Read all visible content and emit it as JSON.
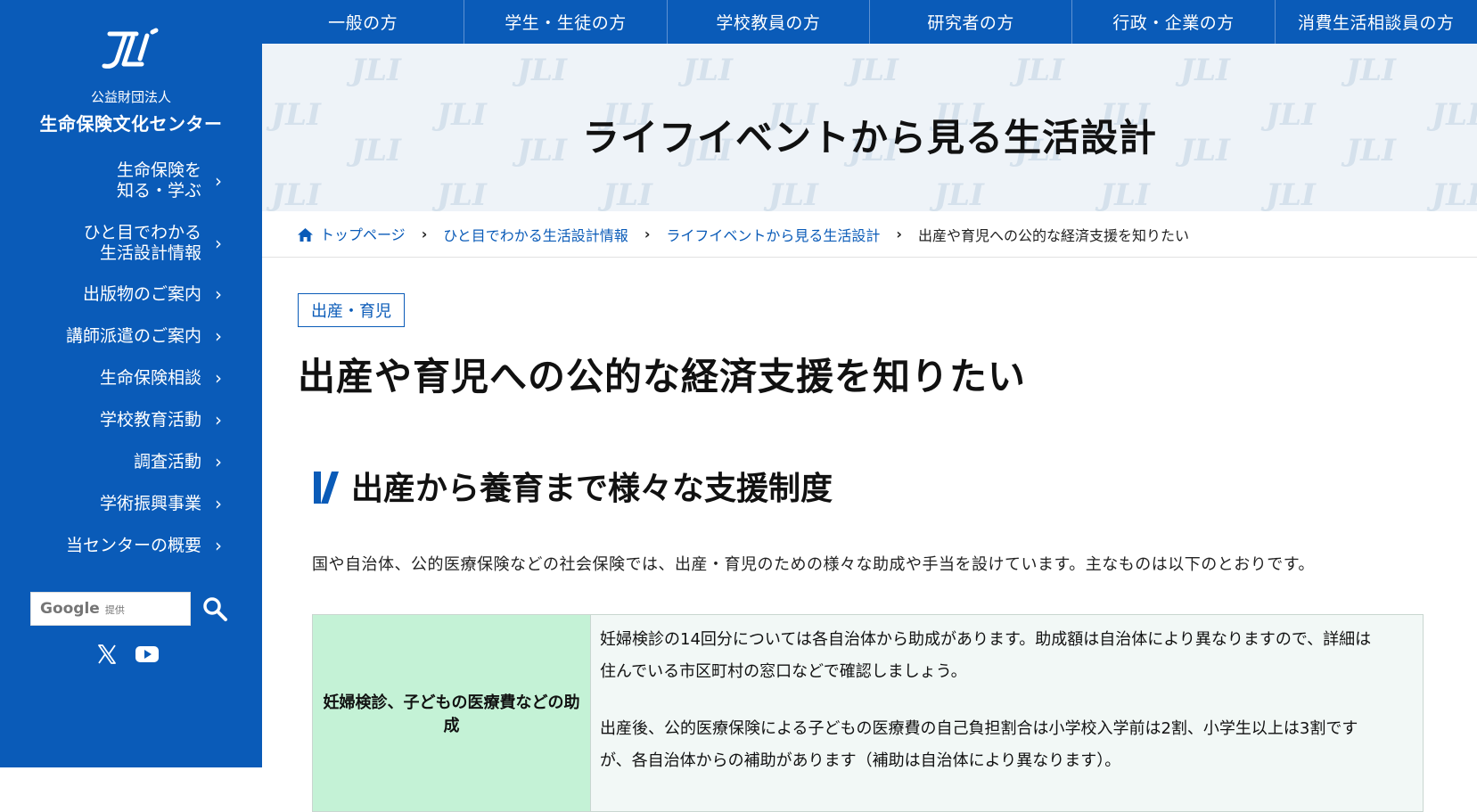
{
  "org": {
    "logo_text": "JLI",
    "subtitle": "公益財団法人",
    "name": "生命保険文化センター"
  },
  "sidebar": {
    "items": [
      {
        "lines": [
          "生命保険を",
          "知る・学ぶ"
        ]
      },
      {
        "lines": [
          "ひと目でわかる",
          "生活設計情報"
        ]
      },
      {
        "lines": [
          "出版物のご案内"
        ]
      },
      {
        "lines": [
          "講師派遣のご案内"
        ]
      },
      {
        "lines": [
          "生命保険相談"
        ]
      },
      {
        "lines": [
          "学校教育活動"
        ]
      },
      {
        "lines": [
          "調査活動"
        ]
      },
      {
        "lines": [
          "学術振興事業"
        ]
      },
      {
        "lines": [
          "当センターの概要"
        ]
      }
    ]
  },
  "search": {
    "google_label": "Google",
    "provider_label": "提供",
    "icon": "search-icon"
  },
  "social": [
    "x-icon",
    "youtube-icon"
  ],
  "topnav": {
    "tabs": [
      "一般の方",
      "学生・生徒の方",
      "学校教員の方",
      "研究者の方",
      "行政・企業の方",
      "消費生活相談員の方"
    ]
  },
  "hero": {
    "title": "ライフイベントから見る生活設計"
  },
  "breadcrumb": {
    "items": [
      "トップページ",
      "ひと目でわかる生活設計情報",
      "ライフイベントから見る生活設計"
    ],
    "current": "出産や育児への公的な経済支援を知りたい"
  },
  "content": {
    "tag": "出産・育児",
    "title": "出産や育児への公的な経済支援を知りたい",
    "section_title": "出産から養育まで様々な支援制度",
    "intro": "国や自治体、公的医療保険などの社会保険では、出産・育児のための様々な助成や手当を設けています。主なものは以下のとおりです。",
    "table": {
      "rows": [
        {
          "label": "妊婦検診、子どもの医療費などの助成",
          "paragraphs": [
            "妊婦検診の14回分については各自治体から助成があります。助成額は自治体により異なりますので、詳細は住んでいる市区町村の窓口などで確認しましょう。",
            "出産後、公的医療保険による子どもの医療費の自己負担割合は小学校入学前は2割、小学生以上は3割ですが、各自治体からの補助があります（補助は自治体により異なります）。"
          ]
        }
      ]
    }
  },
  "colors": {
    "brand_blue": "#0a5bb8",
    "table_header_green": "#c4f2d6",
    "hero_bg": "#eef3f8"
  }
}
